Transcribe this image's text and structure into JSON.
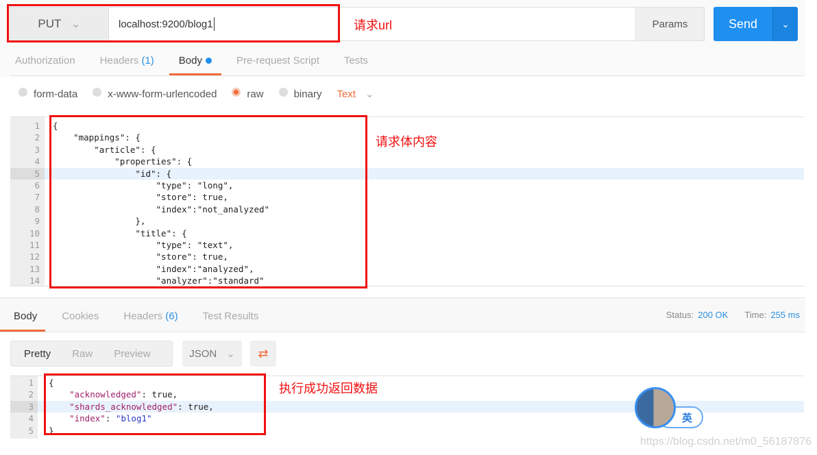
{
  "request": {
    "method": "PUT",
    "url": "localhost:9200/blog1",
    "params_label": "Params",
    "send_label": "Send"
  },
  "annotations": {
    "url": "请求url",
    "body": "请求体内容",
    "response": "执行成功返回数据"
  },
  "request_tabs": [
    {
      "label": "Authorization"
    },
    {
      "label": "Headers",
      "count": "(1)"
    },
    {
      "label": "Body"
    },
    {
      "label": "Pre-request Script"
    },
    {
      "label": "Tests"
    }
  ],
  "body_modes": [
    "form-data",
    "x-www-form-urlencoded",
    "raw",
    "binary"
  ],
  "selected_body_mode": "raw",
  "content_type": "Text",
  "request_body": {
    "line_numbers": [
      "1",
      "2",
      "3",
      "4",
      "5",
      "6",
      "7",
      "8",
      "9",
      "10",
      "11",
      "12",
      "13",
      "14"
    ],
    "lines": [
      "{",
      "    \"mappings\": {",
      "        \"article\": {",
      "            \"properties\": {",
      "                \"id\": {",
      "                    \"type\": \"long\",",
      "                    \"store\": true,",
      "                    \"index\":\"not_analyzed\"",
      "                },",
      "                \"title\": {",
      "                    \"type\": \"text\",",
      "                    \"store\": true,",
      "                    \"index\":\"analyzed\",",
      "                    \"analyzer\":\"standard\""
    ]
  },
  "response_tabs": [
    {
      "label": "Body"
    },
    {
      "label": "Cookies"
    },
    {
      "label": "Headers",
      "count": "(6)"
    },
    {
      "label": "Test Results"
    }
  ],
  "status": {
    "label": "Status:",
    "value": "200 OK",
    "time_label": "Time:",
    "time_value": "255 ms"
  },
  "view_modes": [
    "Pretty",
    "Raw",
    "Preview"
  ],
  "format": "JSON",
  "response_body": {
    "line_numbers": [
      "1",
      "2",
      "3",
      "4",
      "5"
    ],
    "lines": [
      {
        "k": "",
        "rest": "{"
      },
      {
        "k": "    \"acknowledged\"",
        "rest": ": true,"
      },
      {
        "k": "    \"shards_acknowledged\"",
        "rest": ": true,"
      },
      {
        "k": "    \"index\"",
        "rest": ": ",
        "s": "\"blog1\""
      },
      {
        "k": "",
        "rest": "}"
      }
    ]
  },
  "ime_badge": "英",
  "watermark": "https://blog.csdn.net/m0_56187876",
  "colors": {
    "accent": "#f26b3a",
    "send": "#1f8ff0",
    "annotation": "#f01010"
  }
}
